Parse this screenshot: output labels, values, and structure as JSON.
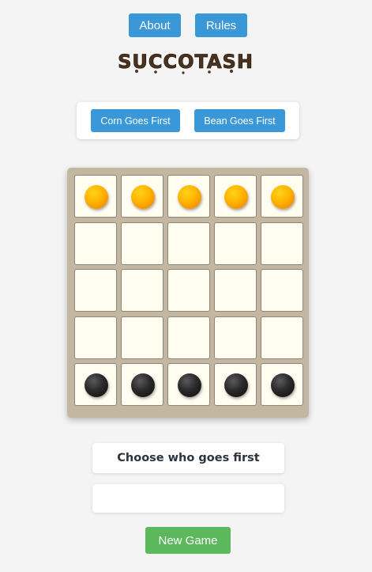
{
  "header": {
    "about_label": "About",
    "rules_label": "Rules",
    "logo_text": "SUCCOTASH"
  },
  "start_choice": {
    "corn_first_label": "Corn Goes First",
    "bean_first_label": "Bean Goes First"
  },
  "board": {
    "rows": 5,
    "cols": 5,
    "cells": [
      [
        "corn",
        "corn",
        "corn",
        "corn",
        "corn"
      ],
      [
        "",
        "",
        "",
        "",
        ""
      ],
      [
        "",
        "",
        "",
        "",
        ""
      ],
      [
        "",
        "",
        "",
        "",
        ""
      ],
      [
        "bean",
        "bean",
        "bean",
        "bean",
        "bean"
      ]
    ]
  },
  "status": {
    "text": "Choose who goes first",
    "message": ""
  },
  "footer": {
    "new_game_label": "New Game"
  },
  "colors": {
    "button_blue": "#3a98d8",
    "new_game_green": "#5cb85c",
    "board_frame": "#c4b7a2",
    "cell_fill": "#fffdf0",
    "corn_piece": "#ffb300",
    "bean_piece": "#222222",
    "page_background": "#f4f4f4"
  }
}
